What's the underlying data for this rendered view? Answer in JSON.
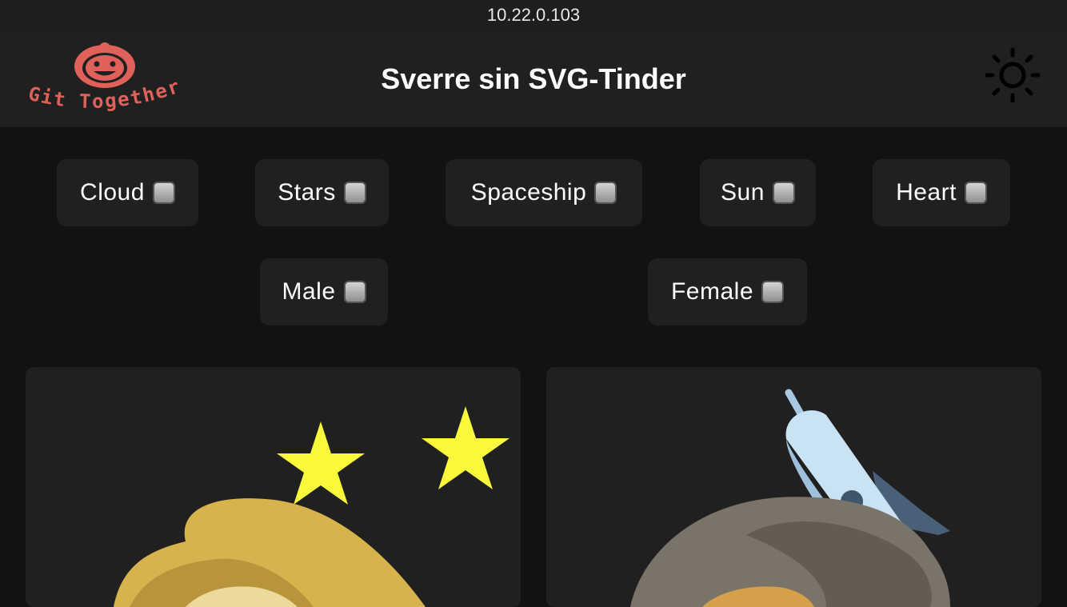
{
  "statusbar": {
    "url": "10.22.0.103"
  },
  "header": {
    "logo_text": "Git Together",
    "title": "Sverre sin SVG-Tinder",
    "theme_icon": "sun-icon"
  },
  "filters": {
    "row1": [
      {
        "label": "Cloud",
        "checked": false
      },
      {
        "label": "Stars",
        "checked": false
      },
      {
        "label": "Spaceship",
        "checked": false
      },
      {
        "label": "Sun",
        "checked": false
      },
      {
        "label": "Heart",
        "checked": false
      }
    ],
    "row2": [
      {
        "label": "Male",
        "checked": false
      },
      {
        "label": "Female",
        "checked": false
      }
    ]
  },
  "cards": [
    {
      "id": "card-1",
      "elements": [
        "stars",
        "blond-hair"
      ]
    },
    {
      "id": "card-2",
      "elements": [
        "spaceship",
        "grey-hair"
      ]
    }
  ],
  "colors": {
    "background": "#121212",
    "surface": "#202020",
    "logo": "#e0615a",
    "star": "#fbf93c",
    "hair_blond": "#d6b34c",
    "hair_grey": "#7a7368",
    "rocket_body": "#c9e3f5",
    "rocket_fin": "#4a6078"
  }
}
